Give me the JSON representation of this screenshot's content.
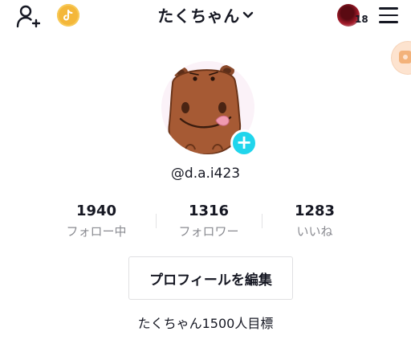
{
  "header": {
    "username_title": "たくちゃん",
    "notification_count": "18"
  },
  "profile": {
    "handle": "@d.a.i423",
    "stats": [
      {
        "value": "1940",
        "label": "フォロー中"
      },
      {
        "value": "1316",
        "label": "フォロワー"
      },
      {
        "value": "1283",
        "label": "いいね"
      }
    ],
    "edit_button_label": "プロフィールを編集",
    "bio": "たくちゃん1500人目標"
  },
  "icons": {
    "add_user": "add-user-icon",
    "coin": "coin-icon",
    "dropdown": "chevron-down-icon",
    "menu": "hamburger-menu-icon",
    "add_avatar": "plus-icon"
  },
  "colors": {
    "accent_cyan": "#20d5ec",
    "coin_gold": "#f4b73a",
    "muted_text": "#8a8b91"
  }
}
